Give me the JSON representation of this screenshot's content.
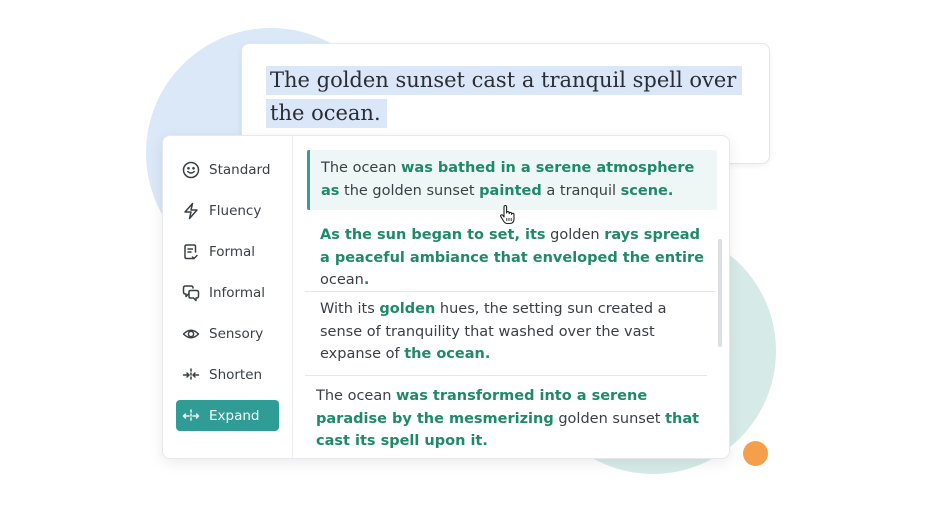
{
  "source": {
    "text_line1": "The golden sunset cast a tranquil spell over",
    "text_line2": "the ocean."
  },
  "modes": [
    {
      "label": "Standard",
      "icon": "smiley-icon"
    },
    {
      "label": "Fluency",
      "icon": "lightning-icon"
    },
    {
      "label": "Formal",
      "icon": "document-check-icon"
    },
    {
      "label": "Informal",
      "icon": "chat-bubbles-icon"
    },
    {
      "label": "Sensory",
      "icon": "eye-icon"
    },
    {
      "label": "Shorten",
      "icon": "shrink-arrows-icon"
    },
    {
      "label": "Expand",
      "icon": "expand-arrows-icon",
      "active": true
    }
  ],
  "suggestions": [
    {
      "selected": true,
      "segments": [
        {
          "text": "The ocean ",
          "hl": false
        },
        {
          "text": "was bathed in a serene atmosphere as",
          "hl": true
        },
        {
          "text": " the golden sunset ",
          "hl": false
        },
        {
          "text": "painted",
          "hl": true
        },
        {
          "text": " a tranquil ",
          "hl": false
        },
        {
          "text": "scene.",
          "hl": true
        }
      ]
    },
    {
      "segments": [
        {
          "text": "As the sun began to set, its",
          "hl": true
        },
        {
          "text": " golden ",
          "hl": false
        },
        {
          "text": "rays spread a peaceful ambiance that enveloped the entire",
          "hl": true
        },
        {
          "text": " ocean",
          "hl": false
        },
        {
          "text": ".",
          "hl": true
        }
      ]
    },
    {
      "segments": [
        {
          "text": "With its ",
          "hl": false
        },
        {
          "text": "golden",
          "hl": true
        },
        {
          "text": " hues, the setting sun created a sense of tranquility that washed over the vast expanse of ",
          "hl": false
        },
        {
          "text": "the ocean.",
          "hl": true
        }
      ]
    },
    {
      "segments": [
        {
          "text": "The ocean ",
          "hl": false
        },
        {
          "text": "was transformed into a serene paradise by the mesmerizing",
          "hl": true
        },
        {
          "text": " golden sunset ",
          "hl": false
        },
        {
          "text": "that cast its spell upon it.",
          "hl": true
        }
      ]
    }
  ],
  "colors": {
    "accent": "#2f9c96",
    "highlight_text": "#1f8a68",
    "source_highlight": "#d9e7f8",
    "deco_blue": "#dbe8f7",
    "deco_teal": "#d6ebe7",
    "deco_orange": "#f4a04a"
  }
}
